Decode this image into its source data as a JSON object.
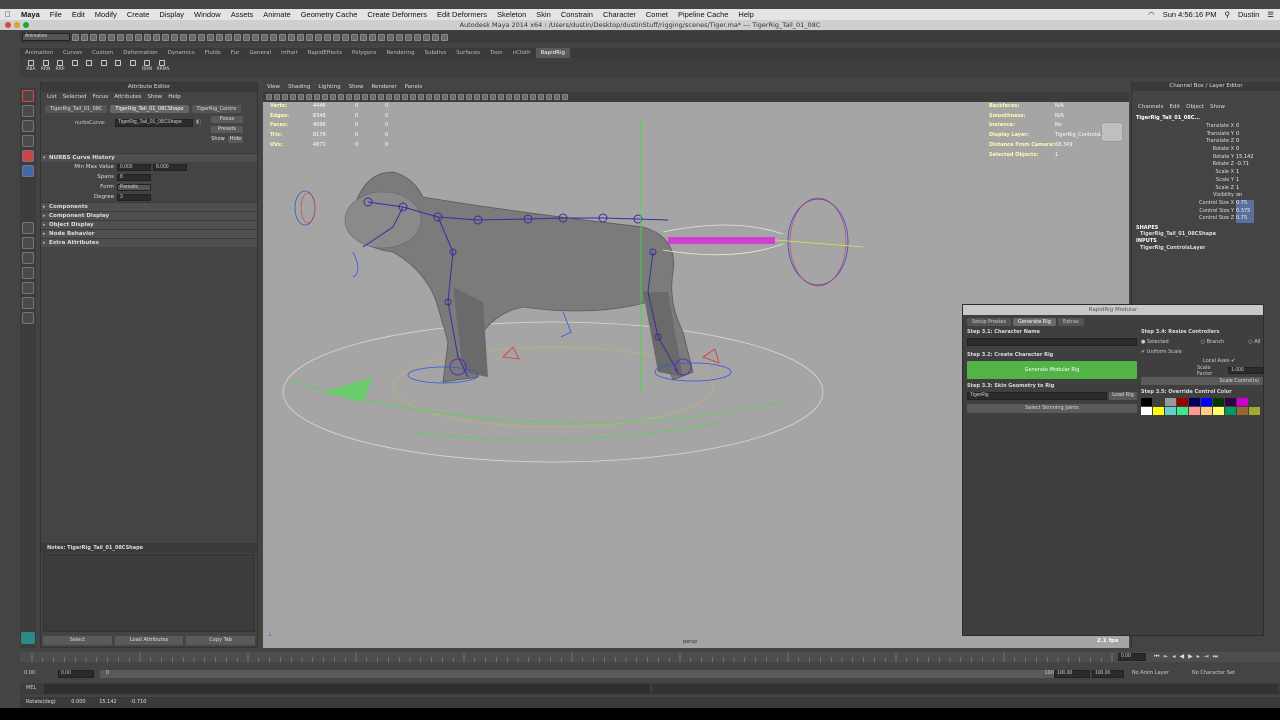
{
  "mac_menu": {
    "app": "Maya",
    "items": [
      "File",
      "Edit",
      "Modify",
      "Create",
      "Display",
      "Window",
      "Assets",
      "Animate",
      "Geometry Cache",
      "Create Deformers",
      "Edit Deformers",
      "Skeleton",
      "Skin",
      "Constrain",
      "Character",
      "Comet",
      "Pipeline Cache",
      "Help"
    ],
    "clock": "Sun 4:56:16 PM",
    "user": "Dustin"
  },
  "window_title": "Autodesk Maya 2014 x64 : /Users/dustin/Desktop/dustinStuff/rigging/scenes/Tiger.ma* --- TigerRig_Tail_01_08C",
  "status_line": {
    "menu_set": "Animation"
  },
  "shelf_tabs": [
    "Animation",
    "Curves",
    "Custom",
    "Deformation",
    "Dynamics",
    "Fluids",
    "Fur",
    "General",
    "mHair",
    "RapidEffects",
    "Polygons",
    "Rendering",
    "Subdivs",
    "Surfaces",
    "Toon",
    "nCloth",
    "RapidRig"
  ],
  "shelf_active": "RapidRig",
  "shelf_buttons": [
    "RBA",
    "RRN",
    "RRP",
    "",
    "",
    "",
    "",
    "",
    "RRM",
    "RRMS"
  ],
  "attribute_editor": {
    "header": "Attribute Editor",
    "menu": [
      "List",
      "Selected",
      "Focus",
      "Attributes",
      "Show",
      "Help"
    ],
    "tabs": [
      "TigerRig_Tail_01_08C",
      "TigerRig_Tail_01_08CShape",
      "TigerRig_Contro"
    ],
    "node_label": "nurbsCurve:",
    "node_value": "TigerRig_Tail_01_08CShape",
    "focus": "Focus",
    "presets": "Presets",
    "show": "Show",
    "hide": "Hide",
    "section_history": "NURBS Curve History",
    "fields": {
      "min_max_label": "Min Max Value",
      "min": "0.000",
      "max": "8.000",
      "spans_label": "Spans",
      "spans": "8",
      "form_label": "Form",
      "form": "Periodic",
      "degree_label": "Degree",
      "degree": "3"
    },
    "sections": [
      "Components",
      "Component Display",
      "Object Display",
      "Node Behavior",
      "Extra Attributes"
    ],
    "notes": "Notes: TigerRig_Tail_01_08CShape",
    "buttons": [
      "Select",
      "Load Attributes",
      "Copy Tab"
    ]
  },
  "viewport": {
    "menu": [
      "View",
      "Shading",
      "Lighting",
      "Show",
      "Renderer",
      "Panels"
    ],
    "hud_left": [
      {
        "k": "Verts:",
        "v1": "4446",
        "v2": "0",
        "v3": "0"
      },
      {
        "k": "Edges:",
        "v1": "8348",
        "v2": "0",
        "v3": "0"
      },
      {
        "k": "Faces:",
        "v1": "4096",
        "v2": "0",
        "v3": "0"
      },
      {
        "k": "Tris:",
        "v1": "8176",
        "v2": "0",
        "v3": "0"
      },
      {
        "k": "UVs:",
        "v1": "4871",
        "v2": "0",
        "v3": "0"
      }
    ],
    "hud_right": [
      {
        "k": "Backfaces:",
        "v": "N/A"
      },
      {
        "k": "Smoothness:",
        "v": "N/A"
      },
      {
        "k": "Instance:",
        "v": "No"
      },
      {
        "k": "Display Layer:",
        "v": "TigerRig_ControlsLayer"
      },
      {
        "k": "Distance From Camera:",
        "v": "68.349"
      },
      {
        "k": "Selected Objects:",
        "v": "1"
      }
    ],
    "camera": "persp",
    "fps": "2.1 fps"
  },
  "channel_box": {
    "header": "Channel Box / Layer Editor",
    "menu": [
      "Channels",
      "Edit",
      "Object",
      "Show"
    ],
    "object": "TigerRig_Tail_01_08C...",
    "channels": [
      {
        "k": "Translate X",
        "v": "0"
      },
      {
        "k": "Translate Y",
        "v": "0"
      },
      {
        "k": "Translate Z",
        "v": "0"
      },
      {
        "k": "Rotate X",
        "v": "0"
      },
      {
        "k": "Rotate Y",
        "v": "15.142"
      },
      {
        "k": "Rotate Z",
        "v": "-0.71"
      },
      {
        "k": "Scale X",
        "v": "1"
      },
      {
        "k": "Scale Y",
        "v": "1"
      },
      {
        "k": "Scale Z",
        "v": "1"
      },
      {
        "k": "Visibility",
        "v": "on"
      },
      {
        "k": "Control Size X",
        "v": "0.75"
      },
      {
        "k": "Control Size Y",
        "v": "0.375"
      },
      {
        "k": "Control Size Z",
        "v": "0.75"
      }
    ],
    "shapes_label": "SHAPES",
    "shape": "TigerRig_Tail_01_08CShape",
    "inputs_label": "INPUTS",
    "input": "TigerRig_ControlsLayer"
  },
  "rapidrig": {
    "title": "RapidRig Modular",
    "tabs": [
      "Setup Proxies",
      "Generate Rig",
      "Extras"
    ],
    "active_tab": "Generate Rig",
    "step31": "Step 3.1: Character Name",
    "step32": "Step 3.2: Create Character Rig",
    "generate": "Generate Modular Rig",
    "step33": "Step 3.3: Skin Geometry to Rig",
    "rig_name": "TigerRig",
    "load_rig": "Load Rig",
    "select_joints": "Select Skinning Joints",
    "step34": "Step 3.4: Resize Controllers",
    "selected": "Selected",
    "branch": "Branch",
    "all": "All",
    "uniform_scale": "Uniform Scale",
    "local_axes": "Local Axes",
    "scale_factor_label": "Scale Factor",
    "scale_factor": "1.000",
    "scale_controls": "Scale Control(s)",
    "step35": "Step 3.5: Override Control Color",
    "palette_row1": [
      "#000000",
      "#404040",
      "#999999",
      "#9b0000",
      "#000059",
      "#0000ff",
      "#003800",
      "#300040",
      "#cc00cc"
    ],
    "palette_row2": [
      "#ffffff",
      "#ffff00",
      "#66cccc",
      "#3ce98c",
      "#ff9999",
      "#ffcc88",
      "#ffff66",
      "#009966",
      "#996633",
      "#a6a633"
    ],
    "accent_green": "#52b347"
  },
  "timeline": {
    "start": "0.00",
    "inner_start": "0.00",
    "current": "0",
    "inner_end": "100",
    "end_inner": "100.00",
    "end": "100.00",
    "frame": "0.00",
    "anim_layer": "No Anim Layer",
    "char_set": "No Character Set"
  },
  "command_line": {
    "lang": "MEL"
  },
  "help_line": {
    "label": "Rotate(deg)",
    "v1": "0.000",
    "v2": "15.142",
    "v3": "-0.710"
  }
}
